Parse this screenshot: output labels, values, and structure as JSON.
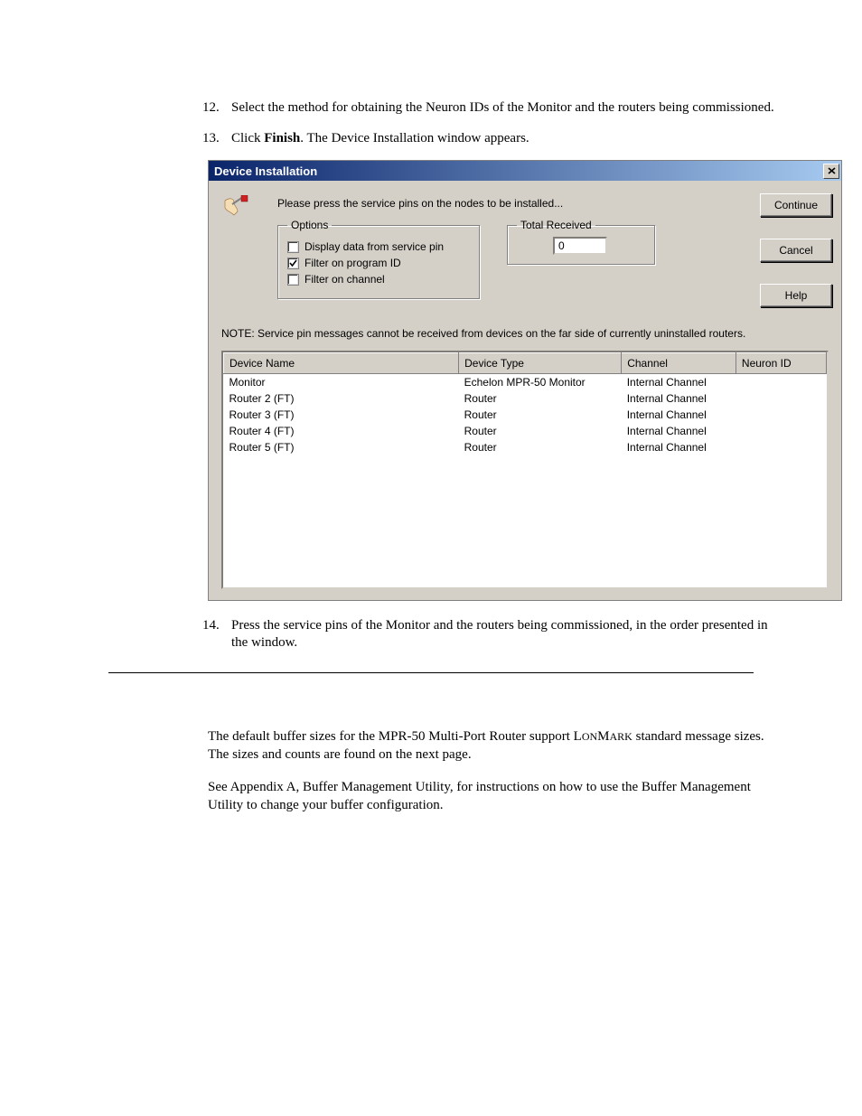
{
  "steps": {
    "s12": {
      "num": "12.",
      "text_a": "Select the method for obtaining the Neuron IDs of the Monitor and the routers being commissioned."
    },
    "s13": {
      "num": "13.",
      "text_a": "Click ",
      "bold": "Finish",
      "text_b": ". The Device Installation window appears."
    },
    "s14": {
      "num": "14.",
      "text_a": "Press the service pins of the Monitor and the routers being commissioned, in the order presented in the window."
    }
  },
  "dialog": {
    "title": "Device Installation",
    "prompt": "Please press the service pins on the nodes to be installed...",
    "options_legend": "Options",
    "opt1": "Display data from service pin",
    "opt2": "Filter on program ID",
    "opt3": "Filter on channel",
    "received_legend": "Total Received",
    "received_value": "0",
    "buttons": {
      "continue": "Continue",
      "cancel": "Cancel",
      "help": "Help"
    },
    "note": "NOTE: Service pin messages cannot be received from devices on the far side of currently uninstalled routers.",
    "headers": {
      "name": "Device Name",
      "type": "Device Type",
      "channel": "Channel",
      "nid": "Neuron ID"
    },
    "rows": [
      {
        "name": "Monitor",
        "type": "Echelon MPR-50 Monitor",
        "channel": "Internal Channel",
        "nid": ""
      },
      {
        "name": "Router 2 (FT)",
        "type": "Router",
        "channel": "Internal Channel",
        "nid": ""
      },
      {
        "name": "Router 3 (FT)",
        "type": "Router",
        "channel": "Internal Channel",
        "nid": ""
      },
      {
        "name": "Router 4 (FT)",
        "type": "Router",
        "channel": "Internal Channel",
        "nid": ""
      },
      {
        "name": "Router 5 (FT)",
        "type": "Router",
        "channel": "Internal Channel",
        "nid": ""
      }
    ]
  },
  "lower": {
    "p1a": "The default buffer sizes for the MPR-50 Multi-Port Router support L",
    "p1b": "ON",
    "p1c": "M",
    "p1d": "ARK",
    "p1e": " standard message sizes.  The sizes and counts are found on the next page.",
    "p2": "See Appendix A, Buffer Management Utility, for instructions on how to use the Buffer Management Utility to change your buffer configuration."
  }
}
